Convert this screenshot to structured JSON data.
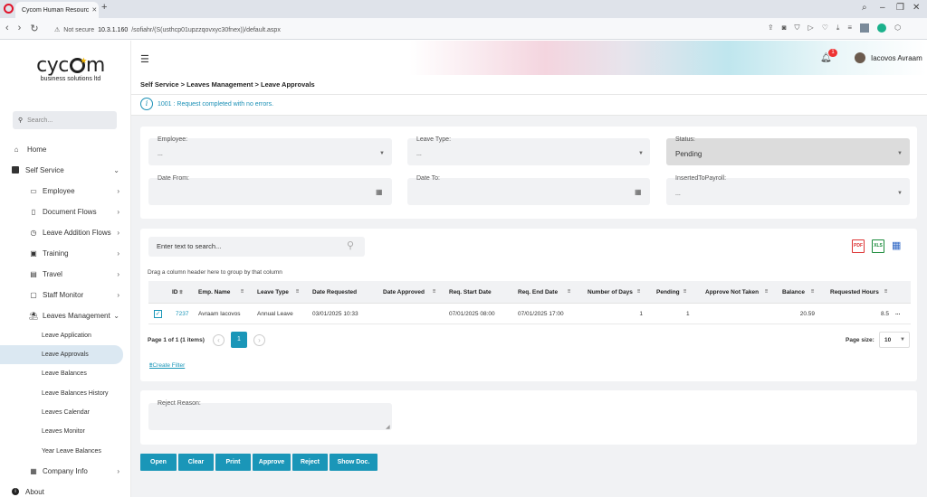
{
  "browser": {
    "tab_title": "Cycom Human Resourc",
    "not_secure": "Not secure",
    "url_host": "10.3.1.160",
    "url_path": "/sofiahr/(S(usthcp01upzzqovxyc30fnex))/default.aspx"
  },
  "sidebar": {
    "logo_text": "cyc m",
    "logo_sub": "business solutions ltd",
    "search_placeholder": "Search...",
    "home": "Home",
    "self_service": "Self Service",
    "items": [
      {
        "label": "Employee",
        "icon": "id-card-icon"
      },
      {
        "label": "Document Flows",
        "icon": "document-icon"
      },
      {
        "label": "Leave Addition Flows",
        "icon": "clock-icon"
      },
      {
        "label": "Training",
        "icon": "training-icon"
      },
      {
        "label": "Travel",
        "icon": "suitcase-icon"
      },
      {
        "label": "Staff Monitor",
        "icon": "monitor-icon"
      },
      {
        "label": "Leaves Management",
        "icon": "beach-icon"
      }
    ],
    "leaves_sub": [
      "Leave Application",
      "Leave Approvals",
      "Leave Balances",
      "Leave Balances History",
      "Leaves Calendar",
      "Leaves Monitor",
      "Year Leave Balances"
    ],
    "company_info": "Company Info",
    "about": "About"
  },
  "header": {
    "notification_count": "1",
    "user_name": "Iacovos Avraam"
  },
  "breadcrumb": "Self Service > Leaves Management > Leave Approvals",
  "message": "1001 : Request completed with no errors.",
  "filters": {
    "employee_label": "Employee:",
    "employee_value": "...",
    "leave_type_label": "Leave Type:",
    "leave_type_value": "...",
    "status_label": "Status:",
    "status_value": "Pending",
    "date_from_label": "Date From:",
    "date_to_label": "Date To:",
    "inserted_label": "InsertedToPayroll:",
    "inserted_value": "..."
  },
  "grid": {
    "search_placeholder": "Enter text to search...",
    "group_hint": "Drag a column header here to group by that column",
    "export_pdf": "PDF",
    "export_xls": "XLS",
    "columns": [
      "ID",
      "Emp. Name",
      "Leave Type",
      "Date Requested",
      "Date Approved",
      "Req. Start Date",
      "Req. End Date",
      "Number of Days",
      "Pending",
      "Approve Not Taken",
      "Balance",
      "Requested Hours"
    ],
    "rows": [
      {
        "id": "7237",
        "emp_name": "Avraam Iacovos",
        "leave_type": "Annual Leave",
        "date_requested": "03/01/2025 10:33",
        "date_approved": "",
        "start": "07/01/2025 08:00",
        "end": "07/01/2025 17:00",
        "days": "1",
        "pending": "1",
        "approve_not_taken": "",
        "balance": "20.59",
        "hours": "8.5",
        "more": "..."
      }
    ],
    "pager_info": "Page 1 of 1 (1 items)",
    "current_page": "1",
    "page_size_label": "Page size:",
    "page_size": "10",
    "create_filter": "Create Filter"
  },
  "reject": {
    "label": "Reject Reason:"
  },
  "buttons": [
    "Open",
    "Clear",
    "Print",
    "Approve",
    "Reject",
    "Show Doc."
  ],
  "colors": {
    "accent": "#1a96b8",
    "info": "#1a8fb5",
    "badge": "#e33333"
  }
}
